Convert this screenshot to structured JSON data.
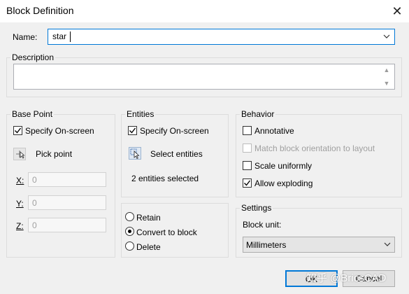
{
  "window": {
    "title": "Block Definition",
    "close_glyph": "✕"
  },
  "name": {
    "label": "Name:",
    "value": "star"
  },
  "description": {
    "label": "Description",
    "value": ""
  },
  "base_point": {
    "group_label": "Base Point",
    "specify_on_screen": {
      "label": "Specify On-screen",
      "checked": true
    },
    "pick_point_label": "Pick point",
    "x": {
      "label": "X:",
      "value": "0"
    },
    "y": {
      "label": "Y:",
      "value": "0"
    },
    "z": {
      "label": "Z:",
      "value": "0"
    }
  },
  "entities": {
    "group_label": "Entities",
    "specify_on_screen": {
      "label": "Specify On-screen",
      "checked": true
    },
    "select_entities_label": "Select entities",
    "status": "2 entities selected",
    "options": [
      {
        "label": "Retain",
        "selected": false
      },
      {
        "label": "Convert to block",
        "selected": true
      },
      {
        "label": "Delete",
        "selected": false
      }
    ]
  },
  "behavior": {
    "group_label": "Behavior",
    "annotative": {
      "label": "Annotative",
      "checked": false
    },
    "match_orientation": {
      "label": "Match block orientation to layout",
      "checked": false,
      "disabled": true
    },
    "scale_uniformly": {
      "label": "Scale uniformly",
      "checked": false
    },
    "allow_exploding": {
      "label": "Allow exploding",
      "checked": true
    }
  },
  "settings": {
    "group_label": "Settings",
    "block_unit_label": "Block unit:",
    "block_unit_value": "Millimeters"
  },
  "buttons": {
    "ok": "OK",
    "cancel": "Cancel"
  },
  "watermark": "知乎 @BricsCAD",
  "colors": {
    "accent": "#0078d7",
    "background": "#f0f0f0"
  }
}
